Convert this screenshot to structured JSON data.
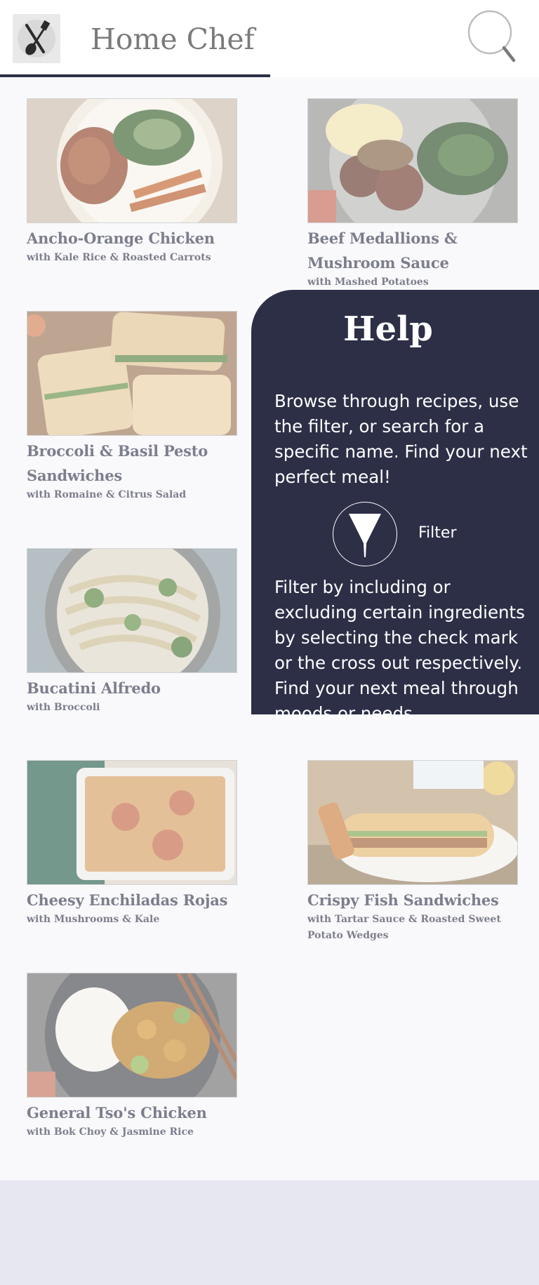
{
  "header": {
    "title": "Home Chef",
    "logo_icon": "utensils-icon",
    "search_icon": "search-icon"
  },
  "recipes": [
    {
      "name": "Ancho-Orange Chicken",
      "subtitle": "with Kale Rice & Roasted Carrots"
    },
    {
      "name": "Beef Medallions & Mushroom Sauce",
      "subtitle": "with Mashed Potatoes"
    },
    {
      "name": "Broccoli & Basil Pesto Sandwiches",
      "subtitle": "with Romaine & Citrus Salad"
    },
    {
      "name": "Bucatini Alfredo",
      "subtitle": "with Broccoli"
    },
    {
      "name": "Cheesy Enchiladas Rojas",
      "subtitle": "with Mushrooms & Kale"
    },
    {
      "name": "Crispy Fish Sandwiches",
      "subtitle": "with Tartar Sauce & Roasted Sweet Potato Wedges"
    },
    {
      "name": "General Tso's Chicken",
      "subtitle": "with Bok Choy & Jasmine Rice"
    }
  ],
  "help": {
    "title": "Help",
    "intro": "Browse through recipes, use the filter, or search for a specific name. Find your next perfect meal!",
    "filter_icon": "filter-icon",
    "filter_label": "Filter",
    "filter_text": "Filter by including or excluding certain ingredients by selecting the check mark or the cross out respectively. Find your next meal through moods or needs"
  },
  "colors": {
    "primary": "#2d2f47",
    "background": "#f5f5f8",
    "footer": "#e6e7f1"
  }
}
